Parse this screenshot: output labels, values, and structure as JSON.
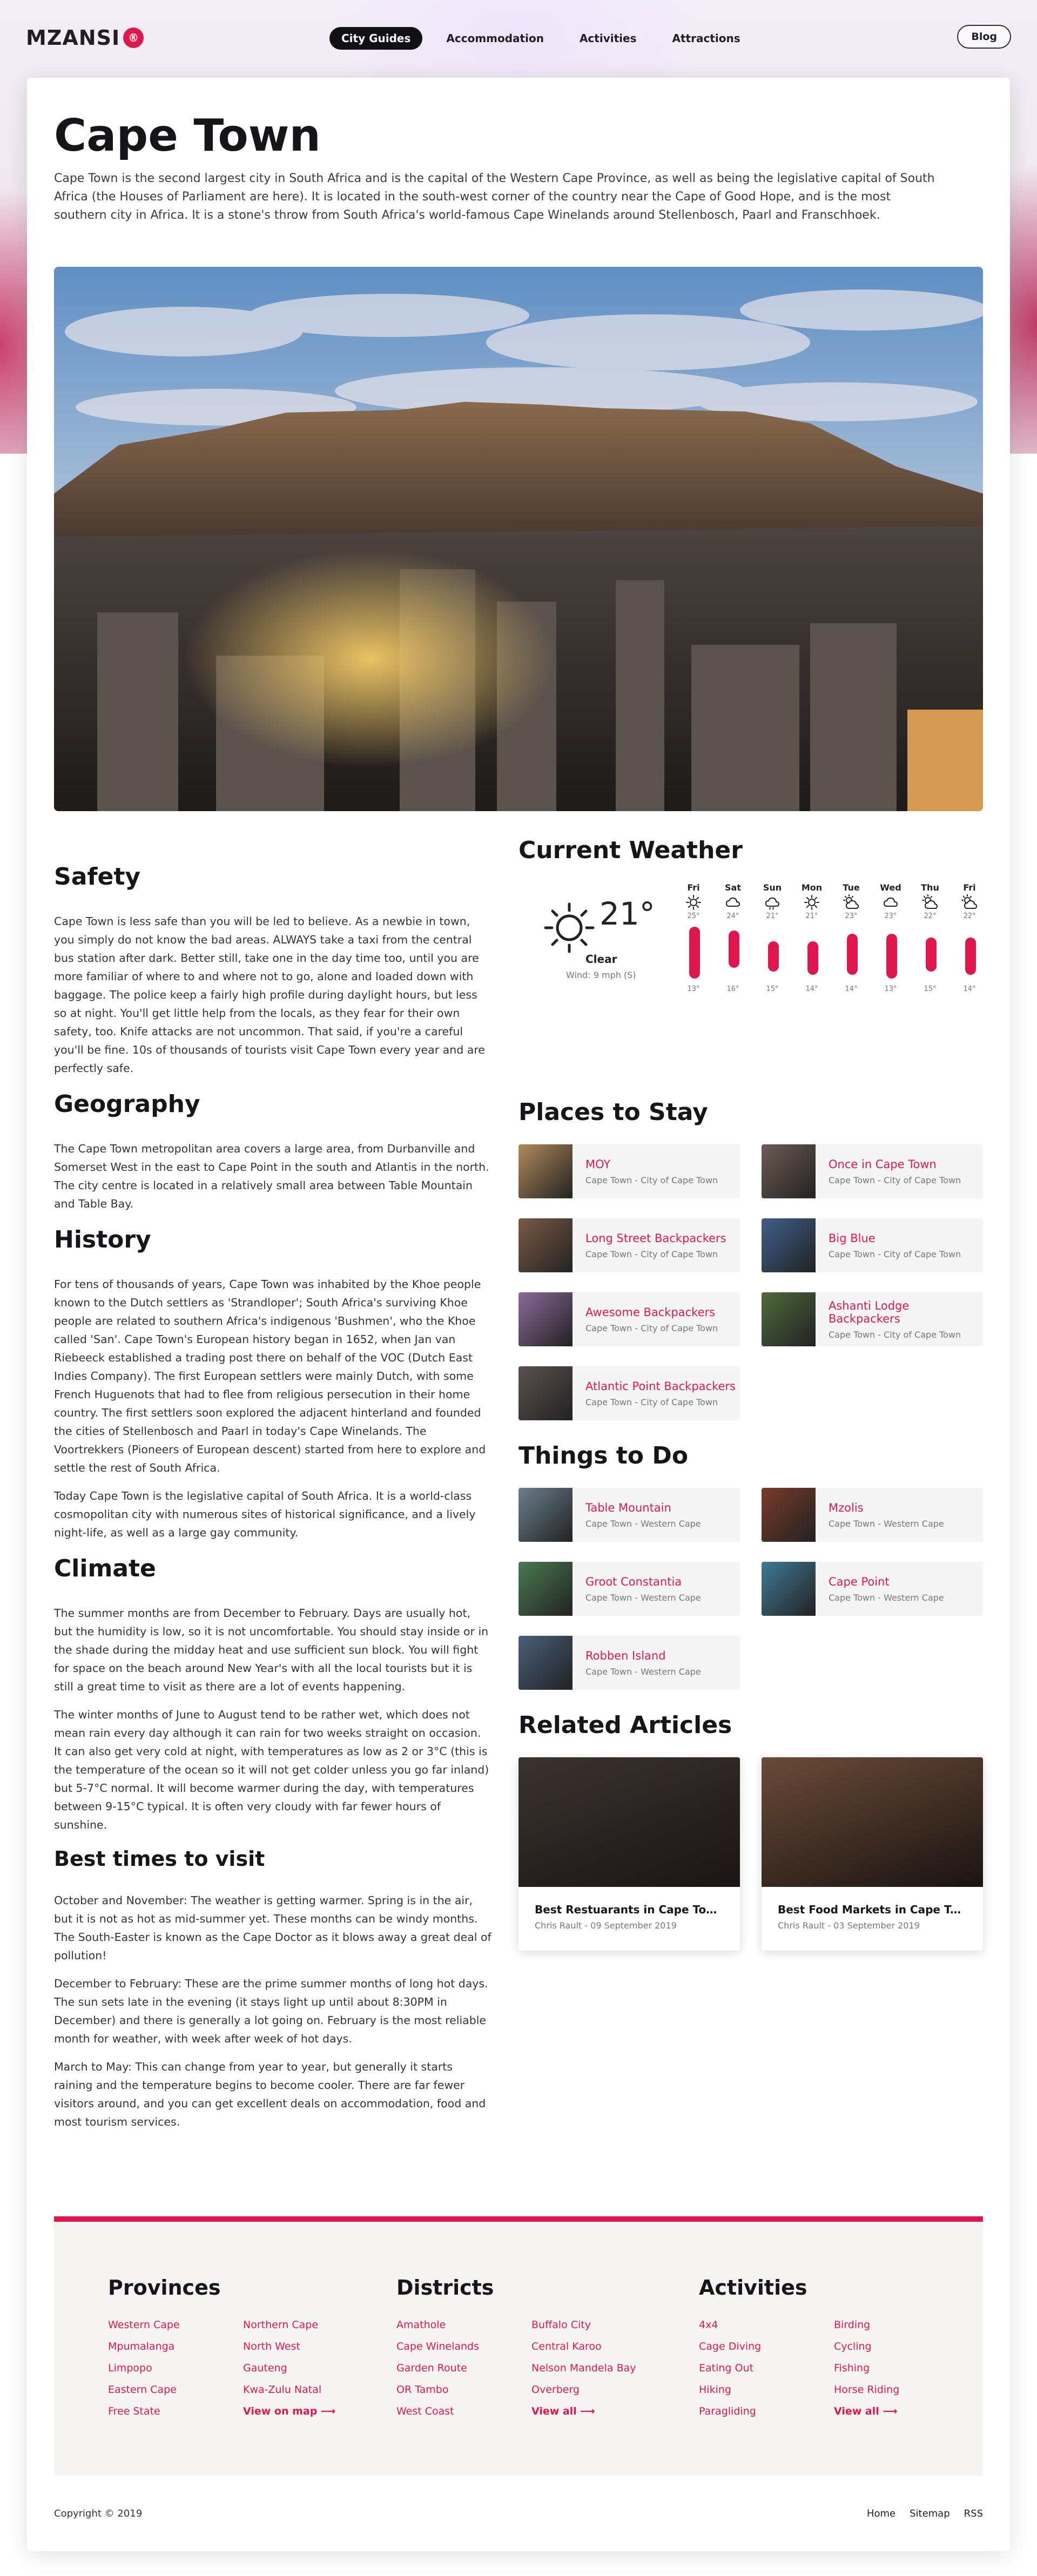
{
  "header": {
    "logo": "MZANSI",
    "logo_badge": "®",
    "nav": [
      "City Guides",
      "Accommodation",
      "Activities",
      "Attractions"
    ],
    "blog": "Blog"
  },
  "page": {
    "title": "Cape Town",
    "intro": "Cape Town is the second largest city in South Africa and is the capital of the Western Cape Province, as well as being the legislative capital of South Africa (the Houses of Parliament are here). It is located in the south-west corner of the country near the Cape of Good Hope, and is the most southern city in Africa. It is a stone's throw from South Africa's world-famous Cape Winelands around Stellenbosch, Paarl and Franschhoek."
  },
  "content": {
    "safety_title": "Safety",
    "safety_p1": "Cape Town is less safe than you will be led to believe. As a newbie in town, you simply do not know the bad areas. ALWAYS take a taxi from the central bus station after dark. Better still, take one in the day time too, until you are more familiar of where to and where not to go, alone and loaded down with baggage. The police keep a fairly high profile during daylight hours, but less so at night. You'll get little help from the locals, as they fear for their own safety, too. Knife attacks are not uncommon. That said, if you're a careful you'll be fine. 10s of thousands of tourists visit Cape Town every year and are perfectly safe.",
    "geography_title": "Geography",
    "geography_p1": "The Cape Town metropolitan area covers a large area, from Durbanville and Somerset West in the east to Cape Point in the south and Atlantis in the north. The city centre is located in a relatively small area between Table Mountain and Table Bay.",
    "history_title": "History",
    "history_p1": "For tens of thousands of years, Cape Town was inhabited by the Khoe people known to the Dutch settlers as 'Strandloper'; South Africa's surviving Khoe people are related to southern Africa's indigenous 'Bushmen', who the Khoe called 'San'. Cape Town's European history began in 1652, when Jan van Riebeeck established a trading post there on behalf of the VOC (Dutch East Indies Company). The first European settlers were mainly Dutch, with some French Huguenots that had to flee from religious persecution in their home country. The first settlers soon explored the adjacent hinterland and founded the cities of Stellenbosch and Paarl in today's Cape Winelands. The Voortrekkers (Pioneers of European descent) started from here to explore and settle the rest of South Africa.",
    "history_p2": "Today Cape Town is the legislative capital of South Africa. It is a world-class cosmopolitan city with numerous sites of historical significance, and a lively night-life, as well as a large gay community.",
    "climate_title": "Climate",
    "climate_p1": "The summer months are from December to February. Days are usually hot, but the humidity is low, so it is not uncomfortable. You should stay inside or in the shade during the midday heat and use sufficient sun block. You will fight for space on the beach around New Year's with all the local tourists but it is still a great time to visit as there are a lot of events happening.",
    "climate_p2": "The winter months of June to August tend to be rather wet, which does not mean rain every day although it can rain for two weeks straight on occasion. It can also get very cold at night, with temperatures as low as 2 or 3°C (this is the temperature of the ocean so it will not get colder unless you go far inland) but 5-7°C normal. It will become warmer during the day, with temperatures between 9-15°C typical. It is often very cloudy with far fewer hours of sunshine.",
    "best_title": "Best times to visit",
    "best_p1": "October and November: The weather is getting warmer. Spring is in the air, but it is not as hot as mid-summer yet. These months can be windy months. The South-Easter is known as the Cape Doctor as it blows away a great deal of pollution!",
    "best_p2": "December to February: These are the prime summer months of long hot days. The sun sets late in the evening (it stays light up until about 8:30PM in December) and there is generally a lot going on. February is the most reliable month for weather, with week after week of hot days.",
    "best_p3": "March to May: This can change from year to year, but generally it starts raining and the temperature begins to become cooler. There are far fewer visitors around, and you can get excellent deals on accommodation, food and most tourism services."
  },
  "weather": {
    "title": "Current Weather",
    "temp": "21°",
    "condition": "Clear",
    "wind": "Wind: 9 mph (S)",
    "days": [
      {
        "name": "Fri",
        "icon": "sun-icon",
        "high": "25°",
        "low": "13°",
        "hi": 25,
        "lo": 13
      },
      {
        "name": "Sat",
        "icon": "cloud-icon",
        "high": "24°",
        "low": "16°",
        "hi": 24,
        "lo": 16
      },
      {
        "name": "Sun",
        "icon": "cloud-rain-icon",
        "high": "21°",
        "low": "15°",
        "hi": 21,
        "lo": 15
      },
      {
        "name": "Mon",
        "icon": "sun-icon",
        "high": "21°",
        "low": "14°",
        "hi": 21,
        "lo": 14
      },
      {
        "name": "Tue",
        "icon": "partly-cloudy-icon",
        "high": "23°",
        "low": "14°",
        "hi": 23,
        "lo": 14
      },
      {
        "name": "Wed",
        "icon": "cloud-icon",
        "high": "23°",
        "low": "13°",
        "hi": 23,
        "lo": 13
      },
      {
        "name": "Thu",
        "icon": "partly-cloudy-icon",
        "high": "22°",
        "low": "15°",
        "hi": 22,
        "lo": 15
      },
      {
        "name": "Fri",
        "icon": "partly-cloudy-icon",
        "high": "22°",
        "low": "14°",
        "hi": 22,
        "lo": 14
      }
    ]
  },
  "stay": {
    "title": "Places to Stay",
    "items": [
      {
        "name": "MOY",
        "sub": "Cape Town - City of Cape Town",
        "color": "#b08a5c"
      },
      {
        "name": "Once in Cape Town",
        "sub": "Cape Town - City of Cape Town",
        "color": "#6b5b55"
      },
      {
        "name": "Long Street Backpackers",
        "sub": "Cape Town - City of Cape Town",
        "color": "#7a5a45"
      },
      {
        "name": "Big Blue",
        "sub": "Cape Town - City of Cape Town",
        "color": "#3f5f8a"
      },
      {
        "name": "Awesome Backpackers",
        "sub": "Cape Town - City of Cape Town",
        "color": "#8a6a9a"
      },
      {
        "name": "Ashanti Lodge Backpackers",
        "sub": "Cape Town - City of Cape Town",
        "color": "#4d6a3c"
      },
      {
        "name": "Atlantic Point Backpackers",
        "sub": "Cape Town - City of Cape Town",
        "color": "#5a5050"
      }
    ]
  },
  "todo": {
    "title": "Things to Do",
    "items": [
      {
        "name": "Table Mountain",
        "sub": "Cape Town - Western Cape",
        "color": "#6a7f8c"
      },
      {
        "name": "Mzolis",
        "sub": "Cape Town - Western Cape",
        "color": "#7a3a2a"
      },
      {
        "name": "Groot Constantia",
        "sub": "Cape Town - Western Cape",
        "color": "#4a7a52"
      },
      {
        "name": "Cape Point",
        "sub": "Cape Town - Western Cape",
        "color": "#3f7a95"
      },
      {
        "name": "Robben Island",
        "sub": "Cape Town - Western Cape",
        "color": "#4a5f7a"
      }
    ]
  },
  "articles": {
    "title": "Related Articles",
    "items": [
      {
        "title": "Best Restuarants in Cape Town - Ultimate Guide",
        "meta": "Chris Rault - 09 September 2019",
        "color": "#3a3330"
      },
      {
        "title": "Best Food Markets in Cape Town",
        "meta": "Chris Rault - 03 September 2019",
        "color": "#6a4a38"
      }
    ]
  },
  "footer": {
    "provinces_title": "Provinces",
    "provinces": [
      "Western Cape",
      "Northern Cape",
      "Mpumalanga",
      "North West",
      "Limpopo",
      "Gauteng",
      "Eastern Cape",
      "Kwa-Zulu Natal",
      "Free State",
      "View on map ⟶"
    ],
    "districts_title": "Districts",
    "districts": [
      "Amathole",
      "Buffalo City",
      "Cape Winelands",
      "Central Karoo",
      "Garden Route",
      "Nelson Mandela Bay",
      "OR Tambo",
      "Overberg",
      "West Coast",
      "View all ⟶"
    ],
    "activities_title": "Activities",
    "activities": [
      "4x4",
      "Birding",
      "Cage Diving",
      "Cycling",
      "Eating Out",
      "Fishing",
      "Hiking",
      "Horse Riding",
      "Paragliding",
      "View all ⟶"
    ],
    "copyright": "Copyright © 2019",
    "legal": [
      "Home",
      "Sitemap",
      "RSS"
    ]
  }
}
